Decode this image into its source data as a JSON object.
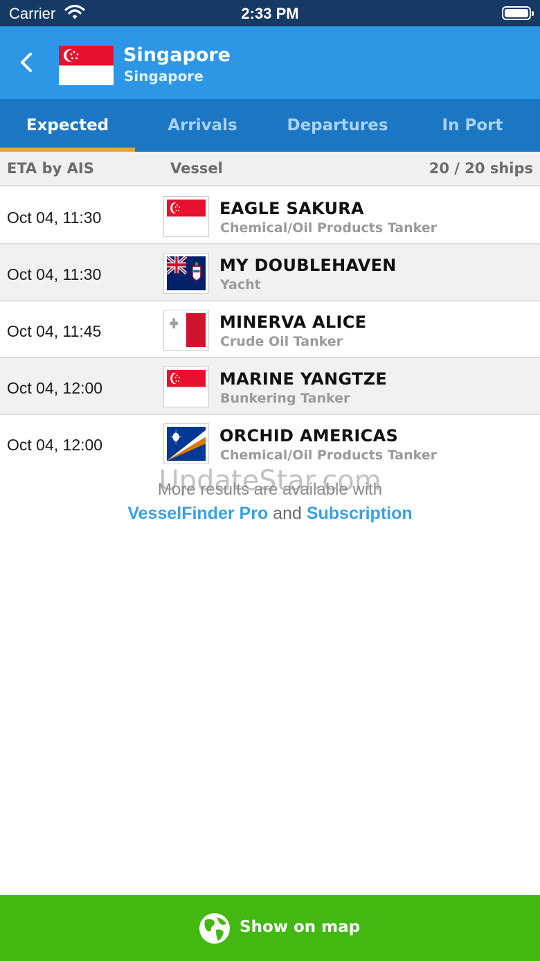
{
  "status_bar": {
    "carrier": "Carrier",
    "time": "2:33 PM"
  },
  "header": {
    "title": "Singapore",
    "subtitle": "Singapore",
    "flag_icon": "singapore-flag-icon"
  },
  "tabs": [
    {
      "label": "Expected",
      "active": true
    },
    {
      "label": "Arrivals",
      "active": false
    },
    {
      "label": "Departures",
      "active": false
    },
    {
      "label": "In Port",
      "active": false
    }
  ],
  "columns": {
    "eta": "ETA by AIS",
    "vessel": "Vessel",
    "count": "20 / 20 ships"
  },
  "ships": [
    {
      "eta": "Oct 04, 11:30",
      "name": "EAGLE SAKURA",
      "type": "Chemical/Oil Products Tanker",
      "flag": "singapore"
    },
    {
      "eta": "Oct 04, 11:30",
      "name": "MY DOUBLEHAVEN",
      "type": "Yacht",
      "flag": "cayman-islands"
    },
    {
      "eta": "Oct 04, 11:45",
      "name": "MINERVA ALICE",
      "type": "Crude Oil Tanker",
      "flag": "malta"
    },
    {
      "eta": "Oct 04, 12:00",
      "name": "MARINE YANGTZE",
      "type": "Bunkering Tanker",
      "flag": "singapore"
    },
    {
      "eta": "Oct 04, 12:00",
      "name": "ORCHID AMERICAS",
      "type": "Chemical/Oil Products Tanker",
      "flag": "marshall-islands"
    }
  ],
  "promo": {
    "line1": "More results are available with",
    "link1": "VesselFinder Pro",
    "connector": "and",
    "link2": "Subscription"
  },
  "watermark": "UpdateStar.com",
  "bottom_bar": {
    "label": "Show on map",
    "icon": "globe-icon"
  },
  "colors": {
    "status_bar": "#163a66",
    "header": "#2e96e6",
    "tab_bar": "#1b76c4",
    "tab_indicator": "#f5a623",
    "link": "#3aa0e6",
    "bottom_bar": "#43b811"
  }
}
